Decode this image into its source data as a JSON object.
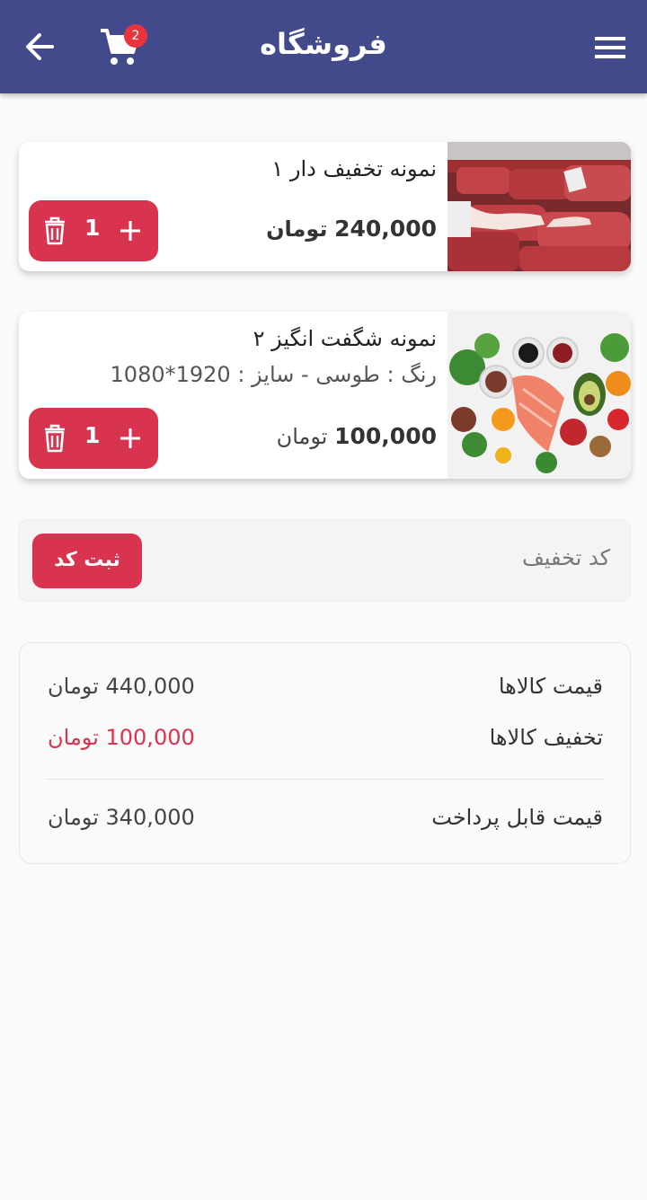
{
  "header": {
    "title": "فروشگاه",
    "cart_count": "2"
  },
  "items": [
    {
      "name": "نمونه تخفیف دار ۱",
      "variant": "",
      "price": "240,000",
      "currency": "تومان",
      "quantity": "1",
      "image": "meat-photo"
    },
    {
      "name": "نمونه شگفت انگیز ۲",
      "variant": "رنگ : طوسی - سایز : 1920*1080",
      "price": "100,000",
      "currency": "تومان",
      "quantity": "1",
      "image": "healthy-food-photo"
    }
  ],
  "coupon": {
    "placeholder": "کد تخفیف",
    "submit_label": "ثبت کد"
  },
  "summary": {
    "items_price_label": "قیمت کالاها",
    "items_price": "440,000 تومان",
    "discount_label": "تخفیف کالاها",
    "discount": "100,000 تومان",
    "payable_label": "قیمت قابل پرداخت",
    "payable": "340,000 تومان"
  },
  "colors": {
    "appbar": "#424a8c",
    "accent": "#d9344f",
    "badge": "#e8343c"
  }
}
